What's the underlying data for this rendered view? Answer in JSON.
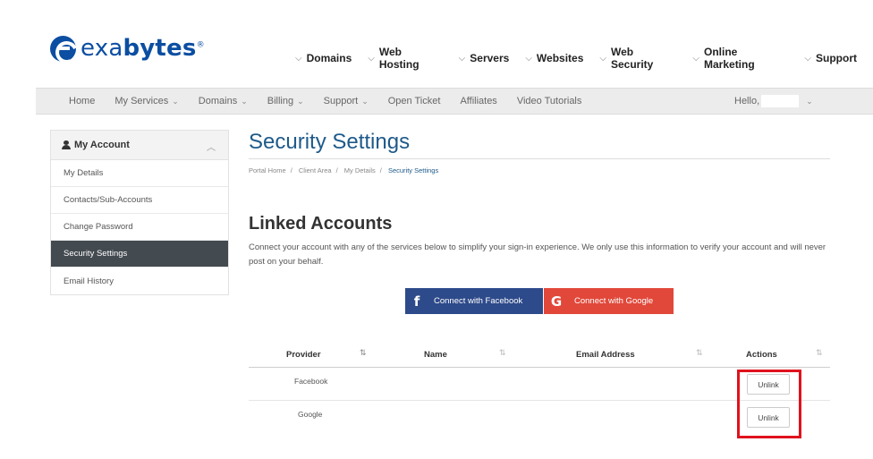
{
  "brand": {
    "name_light": "exa",
    "name_bold": "bytes",
    "reg": "®",
    "accent": "#0b4ea2"
  },
  "main_nav": [
    {
      "label": "Domains"
    },
    {
      "label": "Web Hosting"
    },
    {
      "label": "Servers"
    },
    {
      "label": "Websites"
    },
    {
      "label": "Web Security"
    },
    {
      "label": "Online Marketing"
    },
    {
      "label": "Support"
    }
  ],
  "sub_nav": {
    "items": [
      {
        "label": "Home",
        "caret": ""
      },
      {
        "label": "My Services",
        "caret": "⌄"
      },
      {
        "label": "Domains",
        "caret": "⌄"
      },
      {
        "label": "Billing",
        "caret": "⌄"
      },
      {
        "label": "Support",
        "caret": "⌄"
      },
      {
        "label": "Open Ticket",
        "caret": ""
      },
      {
        "label": "Affiliates",
        "caret": ""
      },
      {
        "label": "Video Tutorials",
        "caret": ""
      }
    ],
    "hello": "Hello,"
  },
  "sidebar": {
    "title": "My Account",
    "items": [
      {
        "label": "My Details"
      },
      {
        "label": "Contacts/Sub-Accounts"
      },
      {
        "label": "Change Password"
      },
      {
        "label": "Security Settings",
        "active": true
      },
      {
        "label": "Email History"
      }
    ]
  },
  "page": {
    "title": "Security Settings",
    "breadcrumb": [
      "Portal Home",
      "Client Area",
      "My Details",
      "Security Settings"
    ],
    "section_title": "Linked Accounts",
    "description": "Connect your account with any of the services below to simplify your sign-in experience. We only use this information to verify your account and will never post on your behalf.",
    "facebook_button": "Connect with Facebook",
    "google_button": "Connect with Google"
  },
  "table": {
    "headers": [
      "Provider",
      "Name",
      "Email Address",
      "Actions"
    ],
    "rows": [
      {
        "provider": "Facebook",
        "name": "",
        "email": "",
        "action": "Unlink"
      },
      {
        "provider": "Google",
        "name": "",
        "email": "",
        "action": "Unlink"
      }
    ]
  },
  "colors": {
    "title_blue": "#1e5a8a",
    "facebook": "#2d4a8a",
    "google": "#e1483a",
    "highlight": "#e0121d",
    "active_sidebar": "#434a50"
  }
}
